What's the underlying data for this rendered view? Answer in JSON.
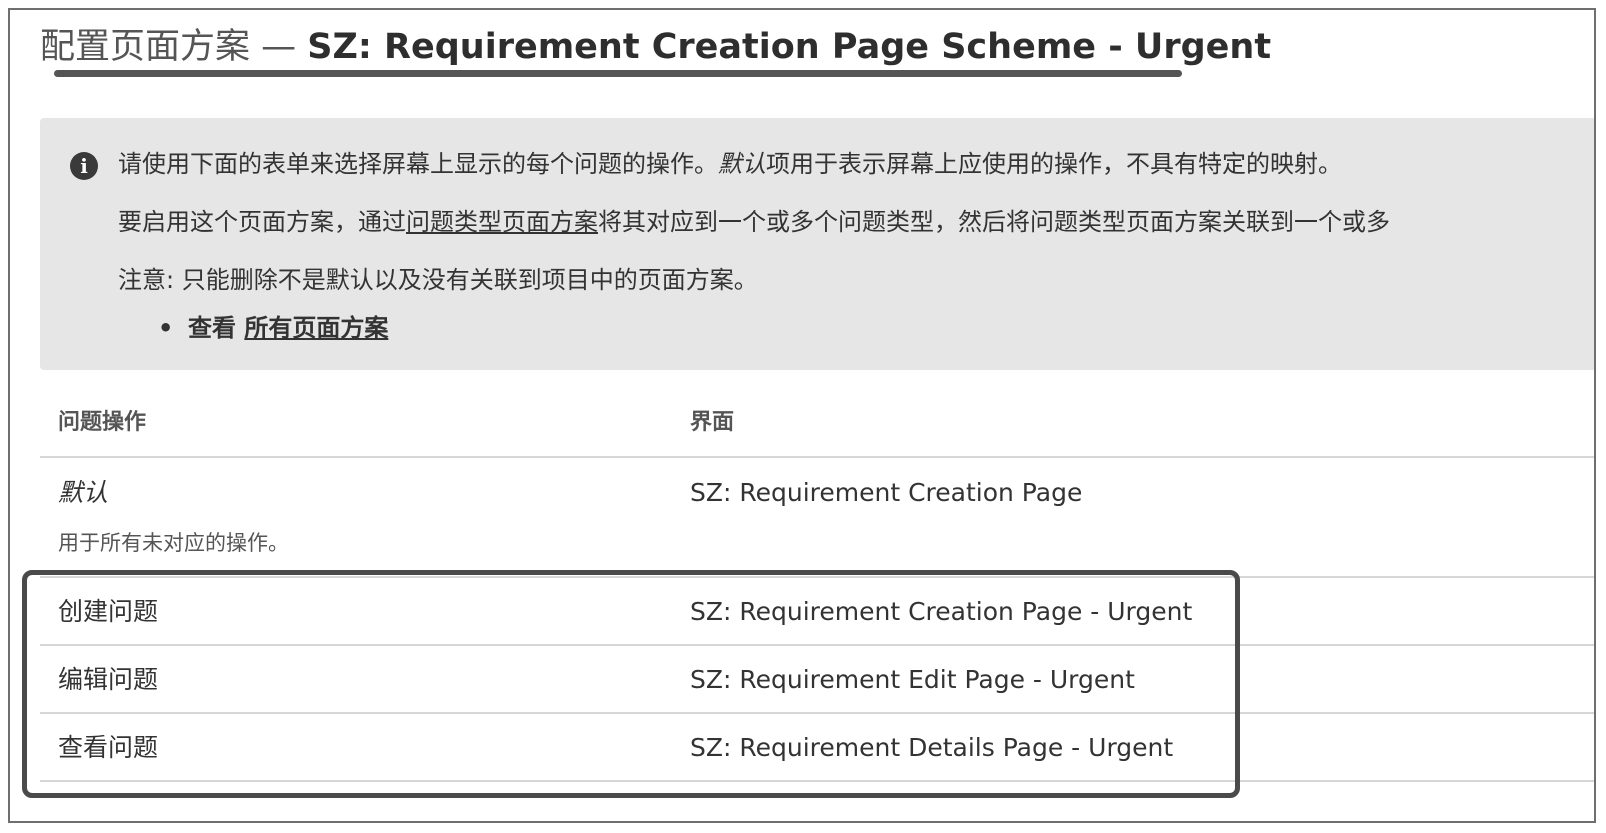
{
  "header": {
    "title_prefix": "配置页面方案 — ",
    "title_name": "SZ: Requirement Creation Page Scheme - Urgent"
  },
  "info": {
    "icon": "info-icon",
    "line1_a": "请使用下面的表单来选择屏幕上显示的每个问题的操作。",
    "line1_default": "默认",
    "line1_b": "项用于表示屏幕上应使用的操作，不具有特定的映射。",
    "line2_a": "要启用这个页面方案，通过",
    "line2_link": "问题类型页面方案",
    "line2_b": "将其对应到一个或多个问题类型，然后将问题类型页面方案关联到一个或多",
    "line3": "注意: 只能删除不是默认以及没有关联到项目中的页面方案。",
    "bullet_label": "查看",
    "bullet_link": "所有页面方案"
  },
  "table": {
    "headers": {
      "operation": "问题操作",
      "screen": "界面"
    },
    "default_row": {
      "operation": "默认",
      "description": "用于所有未对应的操作。",
      "screen": "SZ: Requirement Creation Page"
    },
    "rows": [
      {
        "operation": "创建问题",
        "screen": "SZ: Requirement Creation Page - Urgent"
      },
      {
        "operation": "编辑问题",
        "screen": "SZ: Requirement Edit Page - Urgent"
      },
      {
        "operation": "查看问题",
        "screen": "SZ: Requirement Details Page - Urgent"
      }
    ]
  }
}
